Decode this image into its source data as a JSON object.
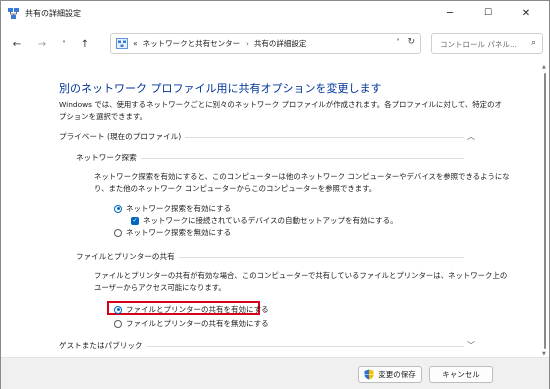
{
  "window": {
    "title": "共有の詳細設定",
    "minimize": "─",
    "maximize": "☐",
    "close": "✕"
  },
  "nav": {
    "back": "←",
    "forward": "→",
    "recent": "˅",
    "up": "↑",
    "breadcrumb_prefix": "«",
    "breadcrumb": [
      "ネットワークと共有センター",
      "共有の詳細設定"
    ],
    "breadcrumb_sep": "›",
    "dropdown": "˅",
    "refresh": "↻",
    "search_placeholder": "コントロール パネル...",
    "search_icon": "⌕"
  },
  "main": {
    "heading": "別のネットワーク プロファイル用に共有オプションを変更します",
    "intro_line1": "Windows では、使用するネットワークごとに別々のネットワーク プロファイルが作成されます。各プロファイルに対して、特定のオ",
    "intro_line2": "プションを選択できます。",
    "private_section": {
      "title": "プライベート (現在のプロファイル)",
      "chevron": "︿"
    },
    "discovery": {
      "title": "ネットワーク探索",
      "desc_line1": "ネットワーク探索を有効にすると、このコンピューターは他のネットワーク コンピューターやデバイスを参照できるようにな",
      "desc_line2": "り、また他のネットワーク コンピューターからこのコンピューターを参照できます。",
      "option_on": "ネットワーク探索を有効にする",
      "option_auto": "ネットワークに接続されているデバイスの自動セットアップを有効にする。",
      "option_off": "ネットワーク探索を無効にする",
      "selected": "on",
      "auto_checked": true
    },
    "file_printer": {
      "title": "ファイルとプリンターの共有",
      "desc_line1": "ファイルとプリンターの共有が有効な場合、このコンピューターで共有しているファイルとプリンターは、ネットワーク上の",
      "desc_line2": "ユーザーからアクセス可能になります。",
      "option_on": "ファイルとプリンターの共有を有効にする",
      "option_off": "ファイルとプリンターの共有を無効にする",
      "selected": "on"
    },
    "guest_section": {
      "title": "ゲストまたはパブリック",
      "chevron": "﹀"
    }
  },
  "footer": {
    "save_label": "変更の保存",
    "cancel_label": "キャンセル"
  },
  "colors": {
    "heading": "#003399",
    "accent": "#0067c0",
    "highlight": "#d6001c"
  }
}
